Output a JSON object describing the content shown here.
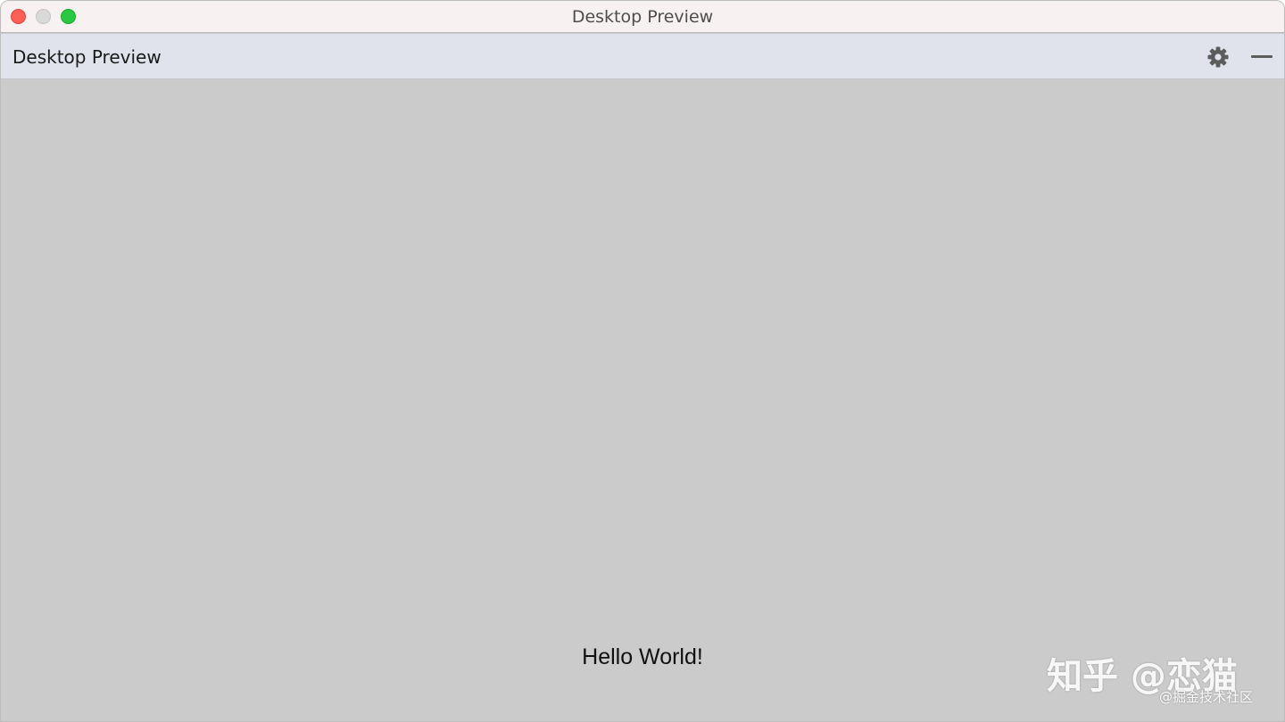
{
  "window": {
    "title": "Desktop Preview"
  },
  "toolbar": {
    "title": "Desktop Preview",
    "icons": [
      "gear-icon",
      "minimize-icon"
    ]
  },
  "content": {
    "text": "Hello World!"
  },
  "watermark": {
    "main": "知乎 @恋猫",
    "sub": "@掘金技术社区"
  },
  "colors": {
    "close": "#fe5f57",
    "minimize_disabled": "#d9d9d9",
    "zoom": "#28c840",
    "toolbar_bg": "#e0e3eb",
    "content_bg": "#cbcbcb",
    "titlebar_bg": "#f7f1f1"
  }
}
